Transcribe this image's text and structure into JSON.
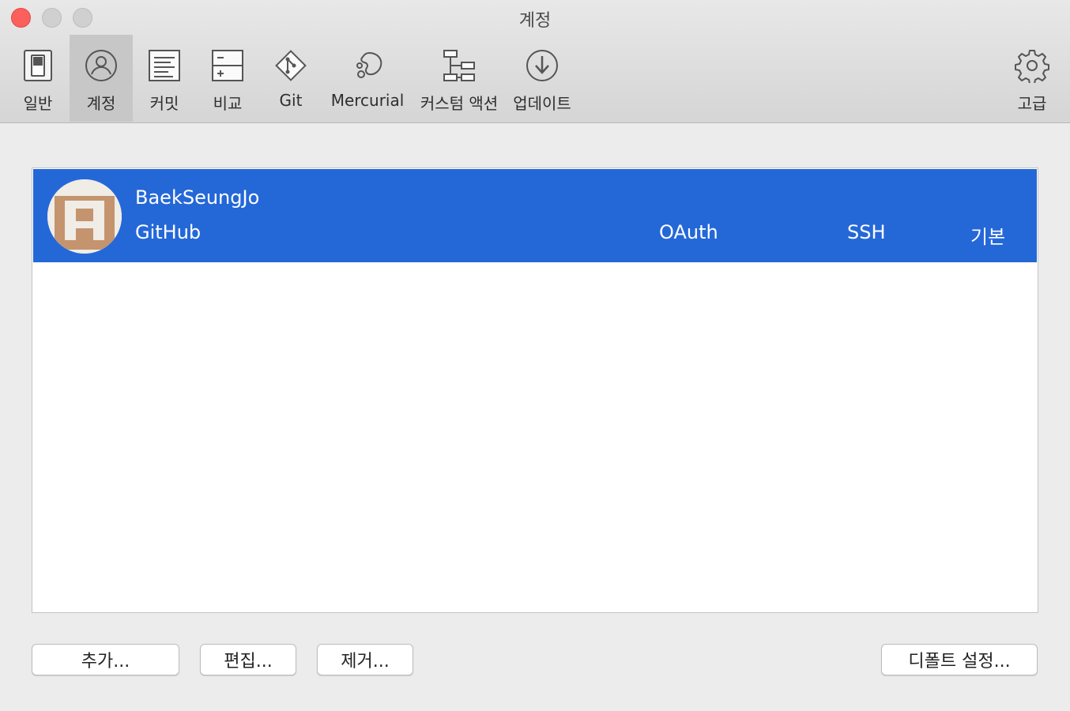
{
  "window": {
    "title": "계정"
  },
  "toolbar": {
    "items": [
      {
        "label": "일반",
        "icon": "switch-icon",
        "active": false
      },
      {
        "label": "계정",
        "icon": "user-icon",
        "active": true
      },
      {
        "label": "커밋",
        "icon": "document-icon",
        "active": false
      },
      {
        "label": "비교",
        "icon": "diff-icon",
        "active": false
      },
      {
        "label": "Git",
        "icon": "git-icon",
        "active": false
      },
      {
        "label": "Mercurial",
        "icon": "mercurial-icon",
        "active": false
      },
      {
        "label": "커스텀 액션",
        "icon": "workflow-icon",
        "active": false
      },
      {
        "label": "업데이트",
        "icon": "download-icon",
        "active": false
      },
      {
        "label": "고급",
        "icon": "gear-icon",
        "active": false
      }
    ]
  },
  "accounts": [
    {
      "username": "BaekSeungJo",
      "host": "GitHub",
      "auth": "OAuth",
      "protocol": "SSH",
      "default": "기본",
      "selected": true
    }
  ],
  "buttons": {
    "add": "추가...",
    "edit": "편집...",
    "remove": "제거...",
    "set_default": "디폴트 설정..."
  },
  "colors": {
    "selection": "#2468d8",
    "close": "#fc605c",
    "avatar": "#c4946e"
  }
}
